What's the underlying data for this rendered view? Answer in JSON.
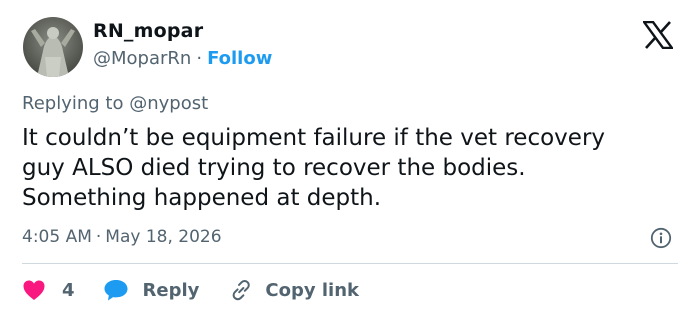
{
  "author": {
    "name": "RN_mopar",
    "handle": "@MoparRn",
    "separator": "·",
    "follow_label": "Follow",
    "avatar_icon": "statue-photo-avatar"
  },
  "brand": {
    "logo": "x-logo-icon"
  },
  "reply_context": {
    "prefix": "Replying to",
    "mention": "@nypost"
  },
  "tweet": {
    "text": "It couldn’t be equipment failure if the vet recovery\nguy ALSO died trying to recover the bodies.\nSomething happened at depth."
  },
  "meta": {
    "time": "4:05 AM",
    "separator": "·",
    "date": "May 18, 2026",
    "info_icon": "info-icon"
  },
  "actions": {
    "like_count": "4",
    "reply_label": "Reply",
    "copy_label": "Copy link"
  },
  "colors": {
    "accent": "#1d9bf0",
    "like": "#f91880",
    "text": "#0f1419",
    "muted": "#536471",
    "divider": "#cfd9de"
  }
}
